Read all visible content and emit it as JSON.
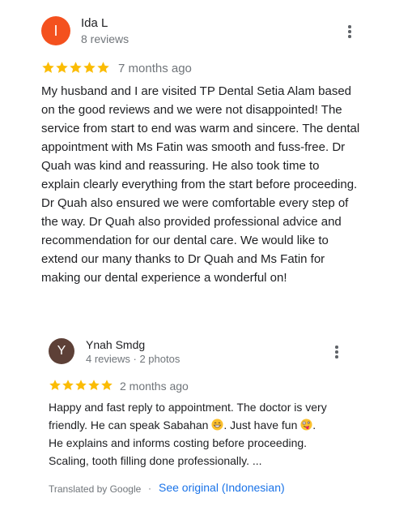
{
  "reviews": [
    {
      "avatar_letter": "I",
      "avatar_color": "#f4511e",
      "name": "Ida L",
      "meta": "8 reviews",
      "rating": 5,
      "time": "7 months ago",
      "text": "My husband and I are visited TP Dental Setia Alam based on the good reviews and we were not disappointed! The service from start to end was warm and sincere. The dental appointment with Ms Fatin was smooth and fuss-free. Dr Quah was kind and reassuring. He also took time to explain clearly everything from the start before proceeding. Dr Quah also ensured we were comfortable every step of the way. Dr Quah also provided professional advice and recommendation for our dental care. We would like to extend our many thanks to Dr Quah and Ms Fatin for making our dental experience a wonderful on!"
    },
    {
      "avatar_letter": "Y",
      "avatar_color": "#5d4037",
      "name": "Ynah Smdg",
      "meta": "4 reviews · 2 photos",
      "rating": 5,
      "time": "2 months ago",
      "text_part1": "Happy and fast reply to appointment. The doctor is very friendly. He can speak Sabahan",
      "emoji1": "grinning-face-with-smiling-eyes",
      "text_part2": ". Just have fun",
      "emoji2": "zany-face",
      "text_part3": ".",
      "text_part4": "He explains and informs costing before proceeding. Scaling, tooth filling done professionally. ...",
      "translated_by": "Translated by Google",
      "separator": "·",
      "see_original": "See original (Indonesian)"
    }
  ],
  "colors": {
    "star": "#fbbc04",
    "link": "#1a73e8",
    "secondary_text": "#70757a"
  }
}
